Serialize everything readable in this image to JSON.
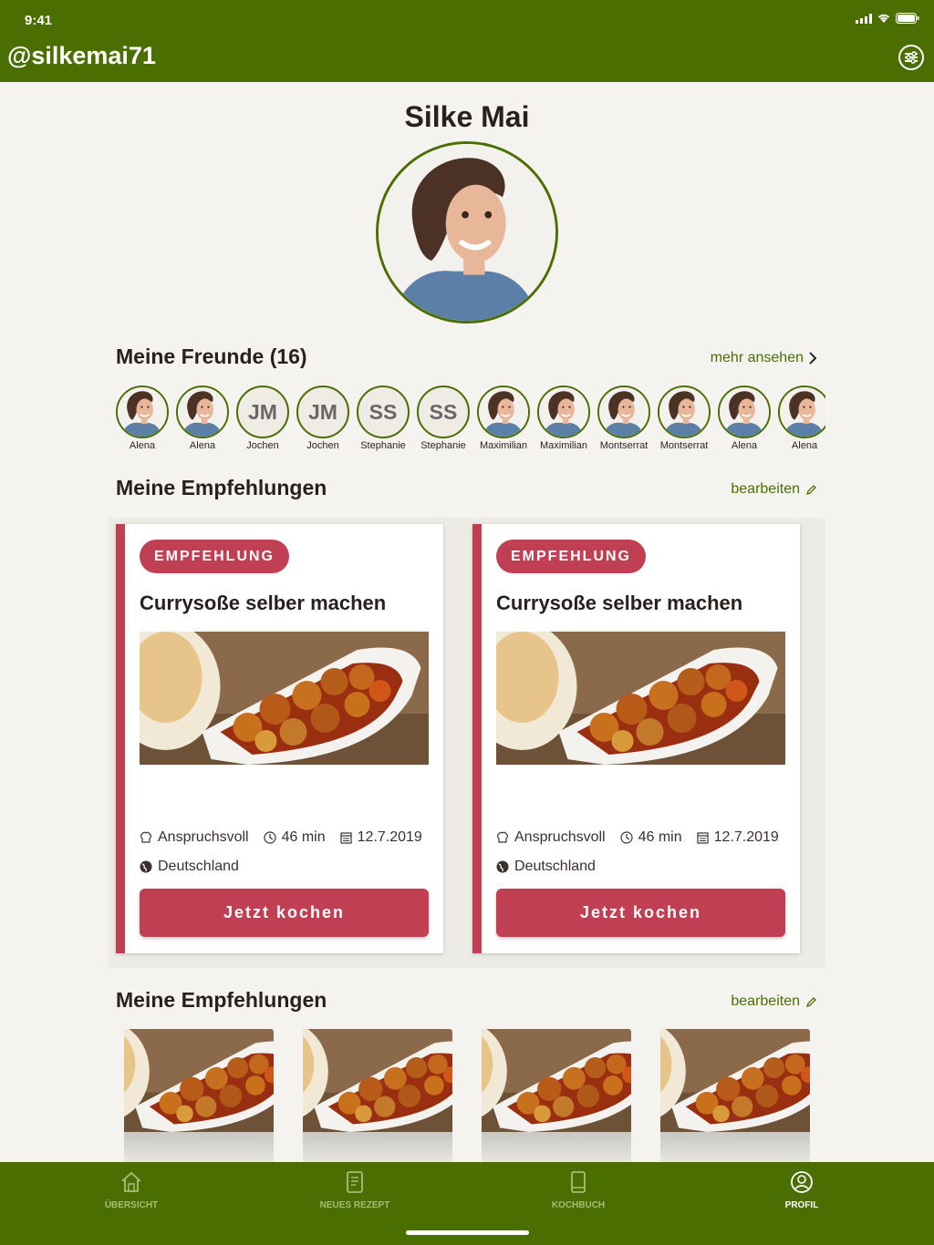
{
  "status": {
    "time": "9:41"
  },
  "header": {
    "handle": "@silkemai71"
  },
  "profile": {
    "name": "Silke Mai"
  },
  "friends_section": {
    "title": "Meine Freunde (16)",
    "more_label": "mehr ansehen",
    "friends": [
      {
        "name": "Alena",
        "initials": ""
      },
      {
        "name": "Alena",
        "initials": ""
      },
      {
        "name": "Jochen",
        "initials": "JM"
      },
      {
        "name": "Jochen",
        "initials": "JM"
      },
      {
        "name": "Stephanie",
        "initials": "SS"
      },
      {
        "name": "Stephanie",
        "initials": "SS"
      },
      {
        "name": "Maximilian",
        "initials": ""
      },
      {
        "name": "Maximilian",
        "initials": ""
      },
      {
        "name": "Montserrat",
        "initials": ""
      },
      {
        "name": "Montserrat",
        "initials": ""
      },
      {
        "name": "Alena",
        "initials": ""
      },
      {
        "name": "Alena",
        "initials": ""
      }
    ]
  },
  "recommendations": {
    "title": "Meine Empfehlungen",
    "edit_label": "bearbeiten",
    "cards": [
      {
        "badge": "EMPFEHLUNG",
        "title": "Currysoße selber machen",
        "difficulty": "Anspruchsvoll",
        "duration": "46 min",
        "date": "12.7.2019",
        "country": "Deutschland",
        "button": "Jetzt kochen"
      },
      {
        "badge": "EMPFEHLUNG",
        "title": "Currysoße selber machen",
        "difficulty": "Anspruchsvoll",
        "duration": "46 min",
        "date": "12.7.2019",
        "country": "Deutschland",
        "button": "Jetzt kochen"
      }
    ]
  },
  "recommendations2": {
    "title": "Meine Empfehlungen",
    "edit_label": "bearbeiten"
  },
  "tabbar": {
    "tabs": [
      {
        "label": "ÜBERSICHT",
        "icon": "home-icon"
      },
      {
        "label": "NEUES REZEPT",
        "icon": "recipe-icon"
      },
      {
        "label": "KOCHBUCH",
        "icon": "book-icon"
      },
      {
        "label": "PROFIL",
        "icon": "profile-icon"
      }
    ],
    "active_index": 3
  },
  "colors": {
    "brand_green": "#4a6e00",
    "accent_red": "#c03f52",
    "background": "#f4f3ef"
  }
}
